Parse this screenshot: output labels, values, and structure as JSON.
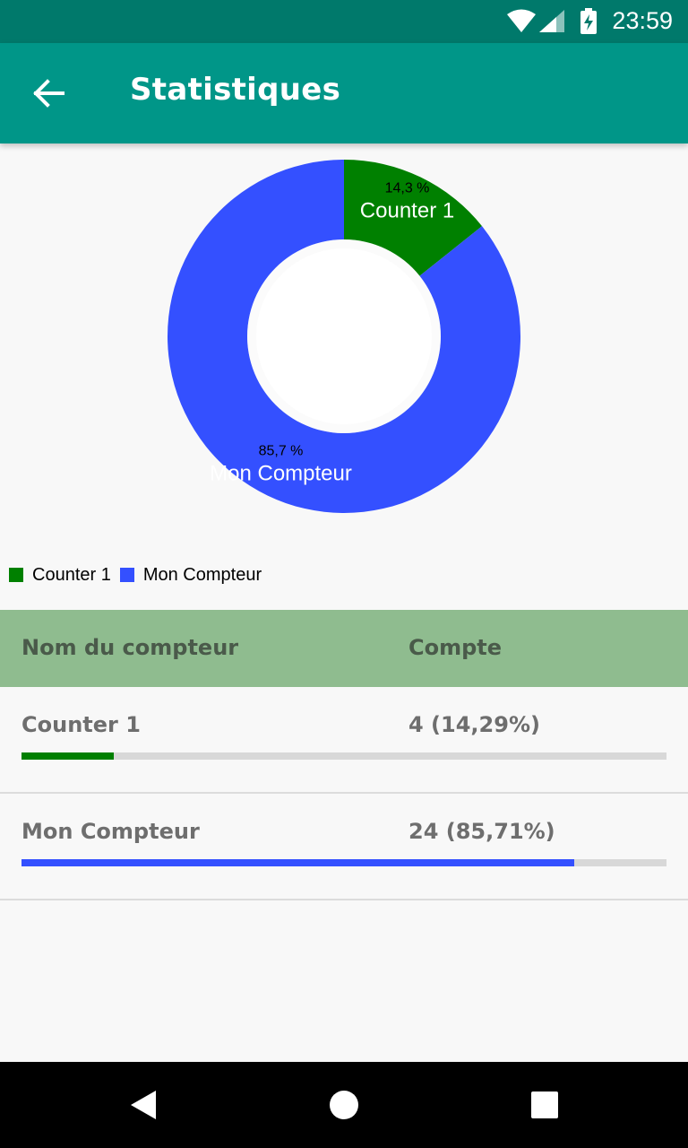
{
  "status_bar": {
    "time": "23:59",
    "icons": [
      "wifi-icon",
      "signal-icon",
      "battery-charging-icon"
    ]
  },
  "app_bar": {
    "title": "Statistiques",
    "back_icon": "arrow-back-icon"
  },
  "chart_data": {
    "type": "pie",
    "donut": true,
    "slices": [
      {
        "label": "Counter 1",
        "value": 4,
        "percent_label": "14,3 %",
        "color": "#008000"
      },
      {
        "label": "Mon Compteur",
        "value": 24,
        "percent_label": "85,7 %",
        "color": "#3450ff"
      }
    ],
    "legend": [
      "Counter 1",
      "Mon Compteur"
    ],
    "legend_placement": "bottom-left"
  },
  "table": {
    "headers": {
      "name": "Nom du compteur",
      "count": "Compte"
    },
    "rows": [
      {
        "name": "Counter 1",
        "count": "4 (14,29%)",
        "fraction": 0.1429,
        "color": "#008000"
      },
      {
        "name": "Mon Compteur",
        "count": "24 (85,71%)",
        "fraction": 0.8571,
        "color": "#3450ff"
      }
    ]
  },
  "colors": {
    "status_bar": "#00796b",
    "app_bar": "#009688",
    "table_header": "#8fbc8f"
  },
  "nav_bar": {
    "icons": [
      "back-triangle-icon",
      "home-circle-icon",
      "recents-square-icon"
    ]
  }
}
